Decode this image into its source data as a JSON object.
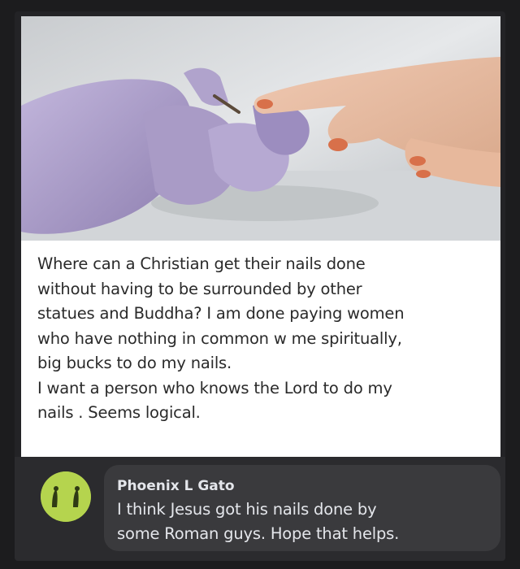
{
  "post": {
    "text": "Where can a Christian get their nails done\nwithout having to be surrounded by other\nstatues and Buddha? I am done paying women\nwho have nothing in common w me  spiritually,\nbig bucks to do my nails.\nI want a person who knows the Lord to do my\nnails . Seems logical."
  },
  "comment": {
    "author": "Phoenix L Gato",
    "text": "I think Jesus got his nails done by\nsome Roman guys. Hope that helps."
  },
  "colors": {
    "background": "#1c1c1e",
    "comment_bubble": "#3a3a3d",
    "avatar": "#b5d44e",
    "glove": "#a99bc6",
    "nail_polish": "#d8704a"
  }
}
